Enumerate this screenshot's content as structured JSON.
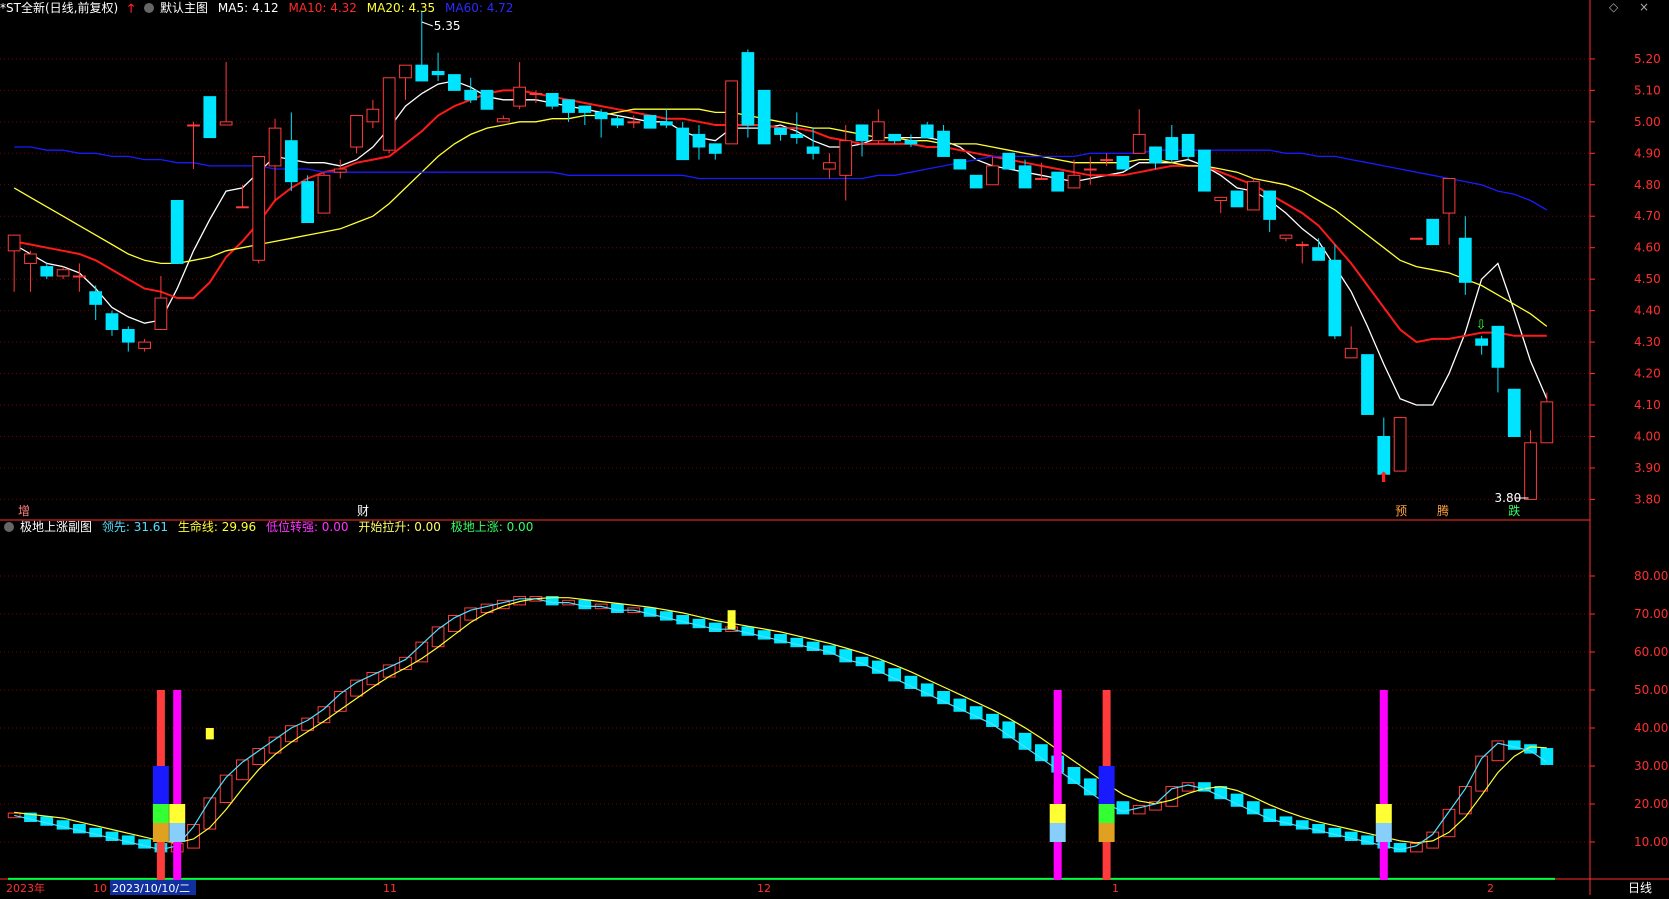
{
  "header": {
    "symbol": "*ST全新(日线,前复权)",
    "template": "默认主图",
    "ma5_label": "MA5: 4.12",
    "ma10_label": "MA10: 4.32",
    "ma20_label": "MA20: 4.35",
    "ma60_label": "MA60: 4.72"
  },
  "sub_header": {
    "title": "极地上涨副图",
    "lead_label": "领先: 31.61",
    "life_label": "生命线: 29.96",
    "turn_label": "低位转强: 0.00",
    "start_label": "开始拉升: 0.00",
    "rise_label": "极地上涨: 0.00"
  },
  "colors": {
    "up": "#ff3b3b",
    "down": "#00e5ff",
    "ma5": "#ffffff",
    "ma10": "#ff1a1a",
    "ma20": "#ffff33",
    "ma60": "#1a1aff",
    "axis": "#ff3030",
    "lead": "#4fe0ff",
    "life": "#ffff33",
    "magenta": "#ff00ff",
    "green": "#00ff40"
  },
  "price_axis": [
    "5.20",
    "5.10",
    "5.00",
    "4.90",
    "4.80",
    "4.70",
    "4.60",
    "4.50",
    "4.40",
    "4.30",
    "4.20",
    "4.10",
    "4.00",
    "3.90",
    "3.80"
  ],
  "sub_axis": [
    "80.00",
    "70.00",
    "60.00",
    "50.00",
    "40.00",
    "30.00",
    "20.00",
    "10.00"
  ],
  "annotations": {
    "high": "5.35",
    "low": "3.80",
    "tag_zeng": "增",
    "tag_cai": "财",
    "tag_yu": "预",
    "tag_teng": "腾",
    "tag_die": "跌"
  },
  "time_axis": {
    "year": "2023年",
    "m10": "10",
    "cursor_date": "2023/10/10/二",
    "m11": "11",
    "m12": "12",
    "m1": "1",
    "m2": "2"
  },
  "period_label": "日线",
  "chart_data": {
    "type": "candlestick",
    "ylim": [
      3.76,
      5.33
    ],
    "candles": [
      [
        4.59,
        4.64,
        4.46,
        4.64
      ],
      [
        4.55,
        4.59,
        4.46,
        4.58
      ],
      [
        4.54,
        4.55,
        4.5,
        4.51
      ],
      [
        4.51,
        4.54,
        4.5,
        4.53
      ],
      [
        4.51,
        4.55,
        4.46,
        4.51
      ],
      [
        4.46,
        4.48,
        4.37,
        4.42
      ],
      [
        4.39,
        4.4,
        4.32,
        4.34
      ],
      [
        4.34,
        4.35,
        4.27,
        4.3
      ],
      [
        4.28,
        4.31,
        4.27,
        4.3
      ],
      [
        4.34,
        4.51,
        4.34,
        4.44
      ],
      [
        4.75,
        4.75,
        4.55,
        4.55
      ],
      [
        4.99,
        5.0,
        4.85,
        4.99
      ],
      [
        5.08,
        5.08,
        4.95,
        4.95
      ],
      [
        4.99,
        5.19,
        4.99,
        5.0
      ],
      [
        4.73,
        4.8,
        4.73,
        4.73
      ],
      [
        4.56,
        4.89,
        4.55,
        4.89
      ],
      [
        4.86,
        5.01,
        4.75,
        4.98
      ],
      [
        4.94,
        5.03,
        4.78,
        4.81
      ],
      [
        4.81,
        4.83,
        4.68,
        4.68
      ],
      [
        4.71,
        4.84,
        4.71,
        4.83
      ],
      [
        4.84,
        4.88,
        4.82,
        4.85
      ],
      [
        4.92,
        5.02,
        4.9,
        5.02
      ],
      [
        5.0,
        5.07,
        4.98,
        5.04
      ],
      [
        4.91,
        5.14,
        4.9,
        5.14
      ],
      [
        5.14,
        5.18,
        5.07,
        5.18
      ],
      [
        5.18,
        5.35,
        5.13,
        5.13
      ],
      [
        5.16,
        5.22,
        5.13,
        5.15
      ],
      [
        5.15,
        5.15,
        5.1,
        5.1
      ],
      [
        5.1,
        5.14,
        5.06,
        5.07
      ],
      [
        5.1,
        5.1,
        5.04,
        5.04
      ],
      [
        5.0,
        5.02,
        5.0,
        5.01
      ],
      [
        5.05,
        5.19,
        5.04,
        5.11
      ],
      [
        5.09,
        5.1,
        5.06,
        5.09
      ],
      [
        5.09,
        5.09,
        5.04,
        5.05
      ],
      [
        5.07,
        5.07,
        5.0,
        5.03
      ],
      [
        5.05,
        5.05,
        4.99,
        5.03
      ],
      [
        5.03,
        5.04,
        4.95,
        5.01
      ],
      [
        5.01,
        5.02,
        4.98,
        4.99
      ],
      [
        5.0,
        5.02,
        4.98,
        5.0
      ],
      [
        5.02,
        5.02,
        4.98,
        4.98
      ],
      [
        5.0,
        5.04,
        4.98,
        4.99
      ],
      [
        4.98,
        5.0,
        4.88,
        4.88
      ],
      [
        4.96,
        4.99,
        4.88,
        4.92
      ],
      [
        4.93,
        4.93,
        4.88,
        4.9
      ],
      [
        4.93,
        5.13,
        4.93,
        5.13
      ],
      [
        5.22,
        5.23,
        4.95,
        4.99
      ],
      [
        5.1,
        5.1,
        4.93,
        4.93
      ],
      [
        4.98,
        4.98,
        4.94,
        4.96
      ],
      [
        4.96,
        5.03,
        4.93,
        4.95
      ],
      [
        4.92,
        4.98,
        4.88,
        4.9
      ],
      [
        4.85,
        4.9,
        4.82,
        4.87
      ],
      [
        4.83,
        4.99,
        4.75,
        4.94
      ],
      [
        4.99,
        4.99,
        4.89,
        4.94
      ],
      [
        4.94,
        5.04,
        4.93,
        5.0
      ],
      [
        4.96,
        4.96,
        4.93,
        4.94
      ],
      [
        4.94,
        4.96,
        4.92,
        4.93
      ],
      [
        4.99,
        5.0,
        4.95,
        4.95
      ],
      [
        4.97,
        4.99,
        4.89,
        4.89
      ],
      [
        4.88,
        4.88,
        4.85,
        4.85
      ],
      [
        4.83,
        4.83,
        4.79,
        4.79
      ],
      [
        4.8,
        4.89,
        4.8,
        4.86
      ],
      [
        4.9,
        4.9,
        4.85,
        4.85
      ],
      [
        4.86,
        4.88,
        4.79,
        4.79
      ],
      [
        4.82,
        4.87,
        4.82,
        4.82
      ],
      [
        4.84,
        4.84,
        4.78,
        4.78
      ],
      [
        4.79,
        4.88,
        4.79,
        4.83
      ],
      [
        4.85,
        4.89,
        4.8,
        4.85
      ],
      [
        4.88,
        4.9,
        4.86,
        4.88
      ],
      [
        4.89,
        4.89,
        4.85,
        4.85
      ],
      [
        4.9,
        5.04,
        4.9,
        4.96
      ],
      [
        4.92,
        4.92,
        4.85,
        4.87
      ],
      [
        4.95,
        4.99,
        4.87,
        4.88
      ],
      [
        4.96,
        4.96,
        4.88,
        4.89
      ],
      [
        4.91,
        4.91,
        4.78,
        4.78
      ],
      [
        4.75,
        4.76,
        4.71,
        4.76
      ],
      [
        4.78,
        4.78,
        4.73,
        4.73
      ],
      [
        4.72,
        4.82,
        4.72,
        4.81
      ],
      [
        4.78,
        4.78,
        4.65,
        4.69
      ],
      [
        4.63,
        4.64,
        4.62,
        4.64
      ],
      [
        4.61,
        4.62,
        4.55,
        4.61
      ],
      [
        4.6,
        4.63,
        4.56,
        4.56
      ],
      [
        4.56,
        4.61,
        4.31,
        4.32
      ],
      [
        4.25,
        4.35,
        4.25,
        4.28
      ],
      [
        4.26,
        4.26,
        4.1,
        4.07
      ],
      [
        4.0,
        4.06,
        3.87,
        3.88
      ],
      [
        3.89,
        4.06,
        3.89,
        4.06
      ],
      [
        4.63,
        4.63,
        4.63,
        4.63
      ],
      [
        4.69,
        4.69,
        4.61,
        4.61
      ],
      [
        4.71,
        4.82,
        4.61,
        4.82
      ],
      [
        4.63,
        4.7,
        4.45,
        4.49
      ],
      [
        4.31,
        4.32,
        4.26,
        4.29
      ],
      [
        4.35,
        4.35,
        4.14,
        4.22
      ],
      [
        4.15,
        4.15,
        4.0,
        4.0
      ],
      [
        3.8,
        4.02,
        3.8,
        3.98
      ],
      [
        3.98,
        4.14,
        3.98,
        4.11
      ]
    ],
    "series": [
      {
        "name": "MA5",
        "values": [
          4.61,
          4.58,
          4.55,
          4.54,
          4.52,
          4.47,
          4.41,
          4.38,
          4.36,
          4.37,
          4.47,
          4.59,
          4.69,
          4.78,
          4.79,
          4.84,
          4.89,
          4.88,
          4.87,
          4.87,
          4.86,
          4.88,
          4.92,
          4.98,
          5.05,
          5.09,
          5.12,
          5.13,
          5.11,
          5.08,
          5.07,
          5.07,
          5.07,
          5.06,
          5.05,
          5.04,
          5.03,
          5.02,
          5.01,
          5.0,
          5.0,
          4.97,
          4.95,
          4.94,
          4.98,
          4.98,
          4.98,
          4.99,
          4.97,
          4.94,
          4.92,
          4.92,
          4.93,
          4.95,
          4.95,
          4.95,
          4.95,
          4.94,
          4.92,
          4.88,
          4.86,
          4.85,
          4.84,
          4.83,
          4.82,
          4.81,
          4.82,
          4.83,
          4.84,
          4.87,
          4.87,
          4.87,
          4.88,
          4.86,
          4.83,
          4.79,
          4.78,
          4.75,
          4.71,
          4.66,
          4.62,
          4.54,
          4.46,
          4.35,
          4.23,
          4.12,
          4.1,
          4.1,
          4.2,
          4.33,
          4.5,
          4.55,
          4.4,
          4.24,
          4.12
        ]
      },
      {
        "name": "MA10",
        "values": [
          4.62,
          4.61,
          4.6,
          4.59,
          4.58,
          4.56,
          4.53,
          4.5,
          4.47,
          4.46,
          4.44,
          4.44,
          4.49,
          4.57,
          4.62,
          4.68,
          4.75,
          4.79,
          4.82,
          4.84,
          4.85,
          4.87,
          4.88,
          4.89,
          4.93,
          4.97,
          5.02,
          5.05,
          5.07,
          5.09,
          5.1,
          5.1,
          5.09,
          5.08,
          5.07,
          5.06,
          5.05,
          5.04,
          5.03,
          5.02,
          5.01,
          5.01,
          5.0,
          4.99,
          4.99,
          4.99,
          4.99,
          4.98,
          4.98,
          4.97,
          4.95,
          4.94,
          4.93,
          4.93,
          4.93,
          4.93,
          4.92,
          4.92,
          4.91,
          4.9,
          4.89,
          4.88,
          4.87,
          4.86,
          4.85,
          4.84,
          4.83,
          4.83,
          4.83,
          4.84,
          4.85,
          4.86,
          4.86,
          4.86,
          4.84,
          4.82,
          4.8,
          4.77,
          4.74,
          4.71,
          4.67,
          4.61,
          4.55,
          4.48,
          4.41,
          4.34,
          4.3,
          4.31,
          4.31,
          4.32,
          4.33,
          4.33,
          4.32,
          4.32,
          4.32
        ]
      },
      {
        "name": "MA20",
        "values": [
          4.79,
          4.76,
          4.73,
          4.7,
          4.67,
          4.64,
          4.61,
          4.58,
          4.56,
          4.55,
          4.55,
          4.56,
          4.57,
          4.59,
          4.6,
          4.61,
          4.62,
          4.63,
          4.64,
          4.65,
          4.66,
          4.68,
          4.7,
          4.74,
          4.79,
          4.84,
          4.89,
          4.93,
          4.96,
          4.98,
          4.99,
          5.0,
          5.0,
          5.01,
          5.01,
          5.02,
          5.02,
          5.03,
          5.04,
          5.04,
          5.04,
          5.04,
          5.04,
          5.03,
          5.03,
          5.02,
          5.01,
          5.0,
          4.99,
          4.98,
          4.98,
          4.97,
          4.96,
          4.95,
          4.95,
          4.94,
          4.94,
          4.93,
          4.93,
          4.93,
          4.92,
          4.91,
          4.9,
          4.89,
          4.88,
          4.87,
          4.87,
          4.87,
          4.87,
          4.88,
          4.88,
          4.87,
          4.86,
          4.86,
          4.85,
          4.84,
          4.82,
          4.81,
          4.8,
          4.78,
          4.75,
          4.72,
          4.68,
          4.64,
          4.6,
          4.56,
          4.54,
          4.53,
          4.52,
          4.5,
          4.48,
          4.45,
          4.42,
          4.39,
          4.35
        ]
      },
      {
        "name": "MA60",
        "values": [
          4.92,
          4.92,
          4.91,
          4.91,
          4.9,
          4.9,
          4.89,
          4.89,
          4.88,
          4.88,
          4.87,
          4.87,
          4.86,
          4.86,
          4.86,
          4.86,
          4.85,
          4.85,
          4.85,
          4.84,
          4.84,
          4.84,
          4.84,
          4.84,
          4.84,
          4.84,
          4.84,
          4.84,
          4.84,
          4.84,
          4.84,
          4.84,
          4.84,
          4.84,
          4.83,
          4.83,
          4.83,
          4.83,
          4.83,
          4.83,
          4.83,
          4.83,
          4.82,
          4.82,
          4.82,
          4.82,
          4.82,
          4.82,
          4.82,
          4.82,
          4.82,
          4.82,
          4.82,
          4.83,
          4.83,
          4.84,
          4.85,
          4.86,
          4.87,
          4.88,
          4.89,
          4.89,
          4.89,
          4.89,
          4.89,
          4.89,
          4.9,
          4.9,
          4.9,
          4.9,
          4.91,
          4.91,
          4.91,
          4.91,
          4.91,
          4.91,
          4.91,
          4.91,
          4.9,
          4.9,
          4.89,
          4.89,
          4.88,
          4.87,
          4.86,
          4.85,
          4.84,
          4.83,
          4.82,
          4.81,
          4.8,
          4.78,
          4.77,
          4.75,
          4.72
        ]
      }
    ],
    "sub": {
      "ylim": [
        0,
        90
      ],
      "lead": [
        17,
        16,
        15,
        14,
        13,
        12,
        11,
        10,
        9,
        8,
        9,
        14,
        21,
        27,
        31,
        34,
        37,
        40,
        42,
        45,
        49,
        52,
        54,
        56,
        58,
        62,
        66,
        69,
        71,
        72,
        73,
        74,
        74,
        73,
        73,
        72,
        72,
        71,
        71,
        70,
        69,
        68,
        67,
        66,
        66,
        65,
        64,
        63,
        62,
        61,
        60,
        58,
        57,
        55,
        53,
        51,
        49,
        47,
        45,
        43,
        41,
        38,
        35,
        32,
        29,
        26,
        23,
        20,
        18,
        19,
        20,
        24,
        25,
        24,
        22,
        20,
        18,
        16,
        15,
        14,
        13,
        12,
        11,
        10,
        9,
        8,
        9,
        12,
        18,
        24,
        32,
        36,
        35,
        34,
        31
      ]
    }
  }
}
